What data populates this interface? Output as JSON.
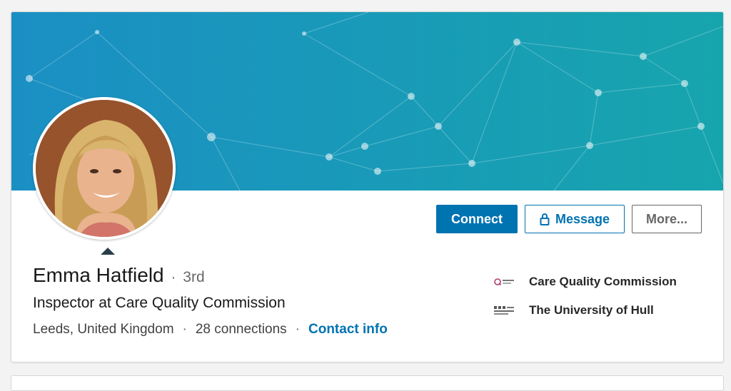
{
  "profile": {
    "name": "Emma Hatfield",
    "degree_separator": "·",
    "degree": "3rd",
    "headline": "Inspector at Care Quality Commission",
    "location": "Leeds, United Kingdom",
    "meta_separator": "·",
    "connections": "28 connections",
    "contact_link": "Contact info"
  },
  "actions": {
    "connect_label": "Connect",
    "message_label": "Message",
    "message_icon": "lock-icon",
    "more_label": "More..."
  },
  "sidebar": {
    "items": [
      {
        "label": "Care Quality Commission",
        "icon": "care-quality-commission-logo"
      },
      {
        "label": "The University of Hull",
        "icon": "university-of-hull-logo"
      }
    ]
  },
  "colors": {
    "primary": "#0073b1",
    "banner_start": "#1b8fc4",
    "banner_end": "#17a5ad"
  }
}
